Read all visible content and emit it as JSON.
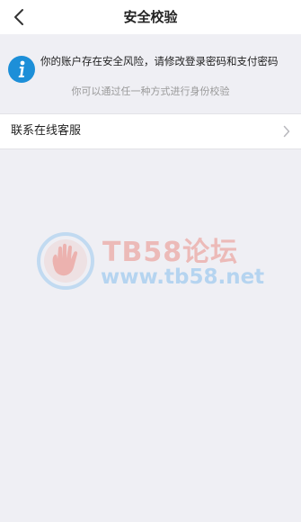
{
  "header": {
    "title": "安全校验",
    "back_icon": "chevron-left-icon"
  },
  "notice": {
    "icon": "info-icon",
    "icon_color": "#1d8fd8",
    "warning": "你的账户存在安全风险，请修改登录密码和支付密码",
    "hint": "你可以通过任一种方式进行身份校验"
  },
  "options": [
    {
      "label": "联系在线客服",
      "icon": "chevron-right-icon"
    }
  ],
  "watermark": {
    "title": "TB58论坛",
    "url": "www.tb58.net",
    "title_color": "#e87a6e",
    "url_color": "#6eb4eb"
  }
}
